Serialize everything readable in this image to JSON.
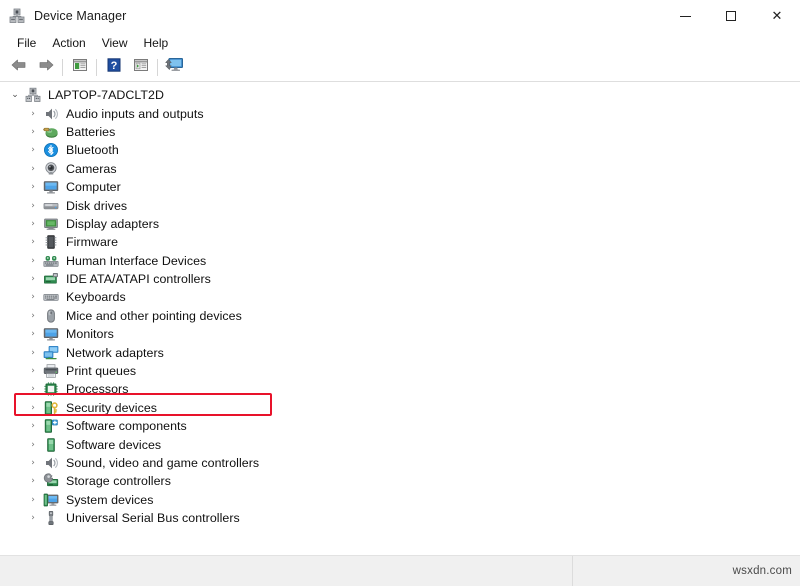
{
  "window": {
    "title": "Device Manager",
    "icon": "device-manager-icon",
    "controls": {
      "minimize": "–",
      "maximize": "□",
      "close": "✕"
    }
  },
  "menubar": {
    "items": [
      {
        "label": "File",
        "name": "menu-file"
      },
      {
        "label": "Action",
        "name": "menu-action"
      },
      {
        "label": "View",
        "name": "menu-view"
      },
      {
        "label": "Help",
        "name": "menu-help"
      }
    ]
  },
  "toolbar": {
    "buttons": [
      {
        "name": "back-button",
        "icon": "back-arrow-icon",
        "tooltip": "Back"
      },
      {
        "name": "forward-button",
        "icon": "forward-arrow-icon",
        "tooltip": "Forward"
      },
      {
        "name": "show-hide-console-tree-button",
        "icon": "console-tree-icon",
        "tooltip": "Show/Hide Console Tree"
      },
      {
        "name": "help-button",
        "icon": "help-question-icon",
        "tooltip": "Help"
      },
      {
        "name": "properties-button",
        "icon": "properties-icon",
        "tooltip": "Properties"
      },
      {
        "name": "scan-hardware-changes-button",
        "icon": "scan-hardware-icon",
        "tooltip": "Scan for hardware changes"
      }
    ]
  },
  "tree": {
    "root": {
      "label": "LAPTOP-7ADCLT2D",
      "icon": "computer-node-icon",
      "expanded": true,
      "chevron": "⌄"
    },
    "chevron_collapsed": "›",
    "items": [
      {
        "label": "Audio inputs and outputs",
        "icon": "speaker-icon",
        "name": "tree-item-audio-inputs-and-outputs",
        "highlighted": false
      },
      {
        "label": "Batteries",
        "icon": "battery-icon",
        "name": "tree-item-batteries",
        "highlighted": false
      },
      {
        "label": "Bluetooth",
        "icon": "bluetooth-icon",
        "name": "tree-item-bluetooth",
        "highlighted": false
      },
      {
        "label": "Cameras",
        "icon": "camera-icon",
        "name": "tree-item-cameras",
        "highlighted": false
      },
      {
        "label": "Computer",
        "icon": "monitor-icon",
        "name": "tree-item-computer",
        "highlighted": false
      },
      {
        "label": "Disk drives",
        "icon": "disk-drive-icon",
        "name": "tree-item-disk-drives",
        "highlighted": false
      },
      {
        "label": "Display adapters",
        "icon": "display-adapter-icon",
        "name": "tree-item-display-adapters",
        "highlighted": false
      },
      {
        "label": "Firmware",
        "icon": "firmware-chip-icon",
        "name": "tree-item-firmware",
        "highlighted": false
      },
      {
        "label": "Human Interface Devices",
        "icon": "hid-icon",
        "name": "tree-item-human-interface-devices",
        "highlighted": false
      },
      {
        "label": "IDE ATA/ATAPI controllers",
        "icon": "ide-controller-icon",
        "name": "tree-item-ide-ata-atapi-controllers",
        "highlighted": false
      },
      {
        "label": "Keyboards",
        "icon": "keyboard-icon",
        "name": "tree-item-keyboards",
        "highlighted": false
      },
      {
        "label": "Mice and other pointing devices",
        "icon": "mouse-icon",
        "name": "tree-item-mice-and-other-pointing-devices",
        "highlighted": true
      },
      {
        "label": "Monitors",
        "icon": "monitor-icon",
        "name": "tree-item-monitors",
        "highlighted": false
      },
      {
        "label": "Network adapters",
        "icon": "network-adapter-icon",
        "name": "tree-item-network-adapters",
        "highlighted": false
      },
      {
        "label": "Print queues",
        "icon": "printer-icon",
        "name": "tree-item-print-queues",
        "highlighted": false
      },
      {
        "label": "Processors",
        "icon": "processor-icon",
        "name": "tree-item-processors",
        "highlighted": false
      },
      {
        "label": "Security devices",
        "icon": "security-device-icon",
        "name": "tree-item-security-devices",
        "highlighted": false
      },
      {
        "label": "Software components",
        "icon": "software-component-icon",
        "name": "tree-item-software-components",
        "highlighted": false
      },
      {
        "label": "Software devices",
        "icon": "software-device-icon",
        "name": "tree-item-software-devices",
        "highlighted": false
      },
      {
        "label": "Sound, video and game controllers",
        "icon": "speaker-icon",
        "name": "tree-item-sound-video-and-game-controllers",
        "highlighted": false
      },
      {
        "label": "Storage controllers",
        "icon": "storage-controller-icon",
        "name": "tree-item-storage-controllers",
        "highlighted": false
      },
      {
        "label": "System devices",
        "icon": "system-device-icon",
        "name": "tree-item-system-devices",
        "highlighted": false
      },
      {
        "label": "Universal Serial Bus controllers",
        "icon": "usb-icon",
        "name": "tree-item-universal-serial-bus-controllers",
        "highlighted": false
      }
    ]
  },
  "statusbar": {
    "left_text": "",
    "watermark": "wsxdn.com"
  },
  "colors": {
    "highlight_box": "#e8122a",
    "bluetooth_blue": "#1a8fe0",
    "chip_green": "#3d8a3d",
    "window_bg": "#ffffff",
    "statusbar_bg": "#f0f0f0"
  }
}
